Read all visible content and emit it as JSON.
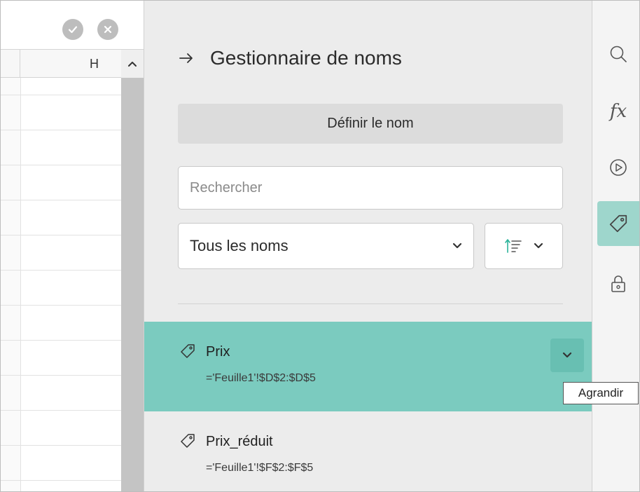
{
  "spreadsheet": {
    "column_label": "H"
  },
  "panel": {
    "title": "Gestionnaire de noms",
    "define_name_label": "Définir le nom",
    "search": {
      "placeholder": "Rechercher",
      "value": ""
    },
    "filter": {
      "selected": "Tous les noms"
    },
    "sort": {
      "icon": "sort-ascending-icon"
    },
    "names": [
      {
        "name": "Prix",
        "reference": "='Feuille1'!$D$2:$D$5",
        "selected": true
      },
      {
        "name": "Prix_réduit",
        "reference": "='Feuille1'!$F$2:$F$5",
        "selected": false
      }
    ],
    "tooltip": "Agrandir"
  },
  "right_toolbar": {
    "items": [
      {
        "icon": "search-icon"
      },
      {
        "icon": "function-icon",
        "label": "fx"
      },
      {
        "icon": "play-icon"
      },
      {
        "icon": "tag-icon",
        "active": true
      },
      {
        "icon": "lock-icon"
      }
    ]
  },
  "colors": {
    "accent": "#7bcbbf",
    "accent_dark": "#68bfb2",
    "active_tool": "#9ed6cc",
    "panel_bg": "#ececec"
  }
}
